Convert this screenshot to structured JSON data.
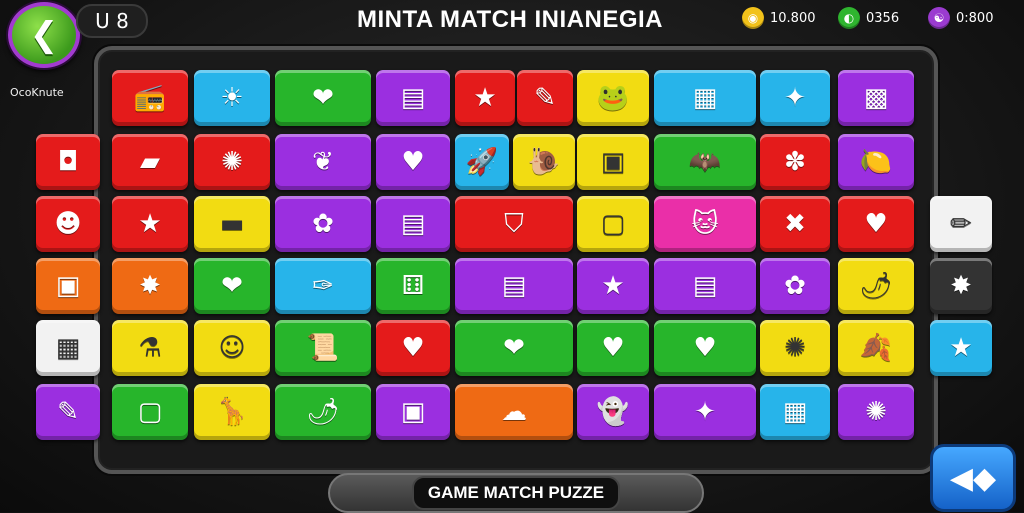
{
  "header": {
    "back_icon": "back-arrow-icon",
    "back_glyph": "❮",
    "level_text": "U 8",
    "title": "MINTA MATCH INIANEGIA",
    "side_label": "OcoKnute"
  },
  "currencies": [
    {
      "name": "gold-coin-icon",
      "value": "10.800",
      "color": "#f2c21a",
      "glyph": "◉"
    },
    {
      "name": "green-gem-icon",
      "value": "0356",
      "color": "#2fb52f",
      "glyph": "◐"
    },
    {
      "name": "purple-gem-icon",
      "value": "0:800",
      "color": "#9b3bd0",
      "glyph": "☯"
    }
  ],
  "footer": {
    "label": "GAME MATCH PUZZE",
    "corner_icon": "shuffle-icon",
    "corner_glyph": "◀◆"
  },
  "tiles": [
    {
      "color": "#e41b1b",
      "icon": "radio-icon",
      "glyph": "📻"
    },
    {
      "color": "#27b4ea",
      "icon": "sun-icon",
      "glyph": "☀"
    },
    {
      "color": "#27b52b",
      "icon": "heart-icon",
      "glyph": "❤"
    },
    {
      "color": "#9b2fe0",
      "icon": "folder-icon",
      "glyph": "▤"
    },
    {
      "color": "#e41b1b",
      "icon": "star-icon",
      "glyph": "★"
    },
    {
      "color": "#e41b1b",
      "icon": "pen-icon",
      "glyph": "✎"
    },
    {
      "color": "#f2dc12",
      "icon": "frog-icon",
      "glyph": "🐸"
    },
    {
      "color": "#27b4ea",
      "icon": "card-icon",
      "glyph": "▦"
    },
    {
      "color": "#27b4ea",
      "icon": "wand-icon",
      "glyph": "✦"
    },
    {
      "color": "#9b2fe0",
      "icon": "calculator-icon",
      "glyph": "▩"
    },
    {
      "color": "#e41b1b",
      "icon": "camera-icon",
      "glyph": "◘"
    },
    {
      "color": "#e41b1b",
      "icon": "bandage-icon",
      "glyph": "▰"
    },
    {
      "color": "#e41b1b",
      "icon": "virus-icon",
      "glyph": "✺"
    },
    {
      "color": "#9b2fe0",
      "icon": "leaf-icon",
      "glyph": "❦"
    },
    {
      "color": "#9b2fe0",
      "icon": "heart-icon",
      "glyph": "♥"
    },
    {
      "color": "#27b4ea",
      "icon": "rocket-icon",
      "glyph": "🚀"
    },
    {
      "color": "#f2dc12",
      "icon": "snail-icon",
      "glyph": "🐌"
    },
    {
      "color": "#f2dc12",
      "icon": "robot-icon",
      "glyph": "▣"
    },
    {
      "color": "#27b52b",
      "icon": "bat-icon",
      "glyph": "🦇"
    },
    {
      "color": "#e41b1b",
      "icon": "gear-icon",
      "glyph": "✽"
    },
    {
      "color": "#9b2fe0",
      "icon": "lemon-icon",
      "glyph": "🍋"
    },
    {
      "color": "#e41b1b",
      "icon": "smiley-icon",
      "glyph": "☻"
    },
    {
      "color": "#e41b1b",
      "icon": "star-icon",
      "glyph": "★"
    },
    {
      "color": "#f2dc12",
      "icon": "sausage-icon",
      "glyph": "▬"
    },
    {
      "color": "#9b2fe0",
      "icon": "flower-icon",
      "glyph": "✿"
    },
    {
      "color": "#9b2fe0",
      "icon": "chest-icon",
      "glyph": "▤"
    },
    {
      "color": "#e41b1b",
      "icon": "shield-icon",
      "glyph": "⛉"
    },
    {
      "color": "#f2dc12",
      "icon": "toast-icon",
      "glyph": "▢"
    },
    {
      "color": "#ea2fa8",
      "icon": "cat-icon",
      "glyph": "🐱"
    },
    {
      "color": "#e41b1b",
      "icon": "cross-icon",
      "glyph": "✖"
    },
    {
      "color": "#e41b1b",
      "icon": "heart-icon",
      "glyph": "♥"
    },
    {
      "color": "#ef6a14",
      "icon": "box-icon",
      "glyph": "▣"
    },
    {
      "color": "#ef6a14",
      "icon": "star-icon",
      "glyph": "✸"
    },
    {
      "color": "#27b52b",
      "icon": "heart-icon",
      "glyph": "❤"
    },
    {
      "color": "#27b4ea",
      "icon": "feather-icon",
      "glyph": "✑"
    },
    {
      "color": "#27b52b",
      "icon": "dice-icon",
      "glyph": "⚅"
    },
    {
      "color": "#9b2fe0",
      "icon": "device-icon",
      "glyph": "▤"
    },
    {
      "color": "#9b2fe0",
      "icon": "star-icon",
      "glyph": "★"
    },
    {
      "color": "#9b2fe0",
      "icon": "note-icon",
      "glyph": "▤"
    },
    {
      "color": "#9b2fe0",
      "icon": "flower-icon",
      "glyph": "✿"
    },
    {
      "color": "#f2dc12",
      "icon": "chili-icon",
      "glyph": "🌶"
    },
    {
      "color": "#f2f2f2",
      "icon": "panel-icon",
      "glyph": "▦"
    },
    {
      "color": "#f2dc12",
      "icon": "bottle-icon",
      "glyph": "⚗"
    },
    {
      "color": "#f2dc12",
      "icon": "face-icon",
      "glyph": "☺"
    },
    {
      "color": "#27b52b",
      "icon": "scroll-icon",
      "glyph": "📜"
    },
    {
      "color": "#e41b1b",
      "icon": "heart-icon",
      "glyph": "♥"
    },
    {
      "color": "#27b52b",
      "icon": "heart-icon",
      "glyph": "❤"
    },
    {
      "color": "#27b52b",
      "icon": "heart-icon",
      "glyph": "♥"
    },
    {
      "color": "#27b52b",
      "icon": "heart-icon",
      "glyph": "♥"
    },
    {
      "color": "#f2dc12",
      "icon": "gear-icon",
      "glyph": "✺"
    },
    {
      "color": "#f2dc12",
      "icon": "leaf-icon",
      "glyph": "🍂"
    },
    {
      "color": "#9b2fe0",
      "icon": "pencil-icon",
      "glyph": "✎"
    },
    {
      "color": "#27b52b",
      "icon": "glass-icon",
      "glyph": "▢"
    },
    {
      "color": "#f2dc12",
      "icon": "giraffe-icon",
      "glyph": "🦒"
    },
    {
      "color": "#27b52b",
      "icon": "chili-icon",
      "glyph": "🌶"
    },
    {
      "color": "#9b2fe0",
      "icon": "disk-icon",
      "glyph": "▣"
    },
    {
      "color": "#ef6a14",
      "icon": "cloud-icon",
      "glyph": "☁"
    },
    {
      "color": "#9b2fe0",
      "icon": "ghost-icon",
      "glyph": "👻"
    },
    {
      "color": "#9b2fe0",
      "icon": "blob-icon",
      "glyph": "✦"
    },
    {
      "color": "#27b4ea",
      "icon": "tv-icon",
      "glyph": "▦"
    },
    {
      "color": "#9b2fe0",
      "icon": "bug-icon",
      "glyph": "✺"
    },
    {
      "color": "#f2f2f2",
      "icon": "pencil-icon",
      "glyph": "✏"
    },
    {
      "color": "#333333",
      "icon": "star-icon",
      "glyph": "✸"
    },
    {
      "color": "#27b4ea",
      "icon": "star-icon",
      "glyph": "★"
    }
  ]
}
